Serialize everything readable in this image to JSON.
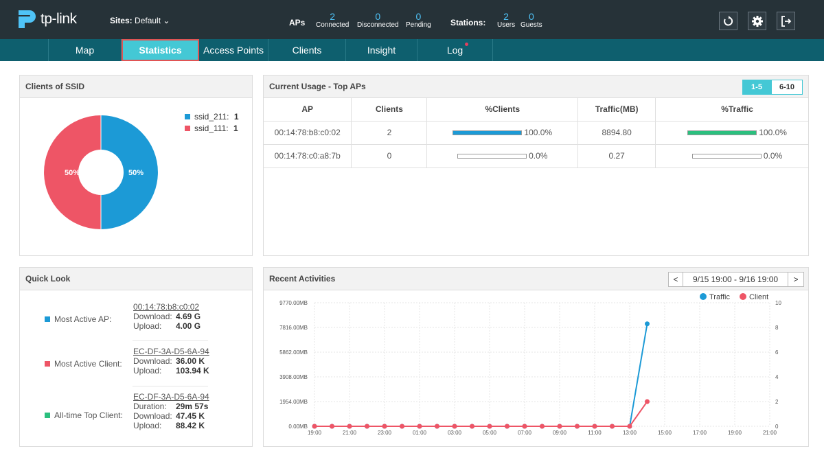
{
  "header": {
    "logo_text": "tp-link",
    "sites_label": "Sites:",
    "sites_value": "Default",
    "aps_label": "APs",
    "aps": [
      {
        "value": "2",
        "label": "Connected"
      },
      {
        "value": "0",
        "label": "Disconnected"
      },
      {
        "value": "0",
        "label": "Pending"
      }
    ],
    "stations_label": "Stations:",
    "stations": [
      {
        "value": "2",
        "label": "Users"
      },
      {
        "value": "0",
        "label": "Guests"
      }
    ],
    "buttons": [
      "refresh-icon",
      "gear-icon",
      "logout-icon"
    ]
  },
  "nav": {
    "items": [
      "Map",
      "Statistics",
      "Access Points",
      "Clients",
      "Insight",
      "Log"
    ],
    "active": "Statistics"
  },
  "clients_of_ssid": {
    "title": "Clients of SSID",
    "legend": [
      {
        "name": "ssid_211:",
        "count": "1",
        "color": "#1c9ad6"
      },
      {
        "name": "ssid_111:",
        "count": "1",
        "color": "#ee5566"
      }
    ],
    "slice_labels": [
      "50%",
      "50%"
    ]
  },
  "current_usage": {
    "title": "Current Usage - Top APs",
    "pager": [
      "1-5",
      "6-10"
    ],
    "columns": [
      "AP",
      "Clients",
      "%Clients",
      "Traffic(MB)",
      "%Traffic"
    ],
    "rows": [
      {
        "ap": "00:14:78:b8:c0:02",
        "clients": "2",
        "pct_clients": "100.0%",
        "pct_clients_fill": 1.0,
        "traffic": "8894.80",
        "pct_traffic": "100.0%",
        "pct_traffic_fill": 1.0
      },
      {
        "ap": "00:14:78:c0:a8:7b",
        "clients": "0",
        "pct_clients": "0.0%",
        "pct_clients_fill": 0.0,
        "traffic": "0.27",
        "pct_traffic": "0.0%",
        "pct_traffic_fill": 0.0
      }
    ]
  },
  "quick_look": {
    "title": "Quick Look",
    "items": [
      {
        "label": "Most Active AP:",
        "color": "#1c9ad6",
        "link": "00:14:78:b8:c0:02",
        "kv": [
          {
            "k": "Download:",
            "v": "4.69 G"
          },
          {
            "k": "Upload:",
            "v": "4.00 G"
          }
        ]
      },
      {
        "label": "Most Active Client:",
        "color": "#ee5566",
        "link": "EC-DF-3A-D5-6A-94",
        "kv": [
          {
            "k": "Download:",
            "v": "36.00 K"
          },
          {
            "k": "Upload:",
            "v": "103.94 K"
          }
        ]
      },
      {
        "label": "All-time Top Client:",
        "color": "#2bbf7e",
        "link": "EC-DF-3A-D5-6A-94",
        "kv": [
          {
            "k": "Duration:",
            "v": "29m 57s"
          },
          {
            "k": "Download:",
            "v": "47.45 K"
          },
          {
            "k": "Upload:",
            "v": "88.42 K"
          }
        ]
      }
    ]
  },
  "recent": {
    "title": "Recent Activities",
    "range": "9/15 19:00 - 9/16 19:00",
    "prev": "<",
    "next": ">"
  },
  "chart_data": {
    "type": "line",
    "x": [
      "19:00",
      "20:00",
      "21:00",
      "22:00",
      "23:00",
      "00:00",
      "01:00",
      "02:00",
      "03:00",
      "04:00",
      "05:00",
      "06:00",
      "07:00",
      "08:00",
      "09:00",
      "10:00",
      "11:00",
      "12:00",
      "13:00",
      "14:00"
    ],
    "x_ticks": [
      "19:00",
      "21:00",
      "23:00",
      "01:00",
      "03:00",
      "05:00",
      "07:00",
      "09:00",
      "11:00",
      "13:00",
      "15:00",
      "17:00",
      "19:00",
      "21:00"
    ],
    "y_left_ticks": [
      "0.00MB",
      "1954.00MB",
      "3908.00MB",
      "5862.00MB",
      "7816.00MB",
      "9770.00MB"
    ],
    "y_left_range": [
      0,
      9770
    ],
    "y_right_ticks": [
      "0",
      "2",
      "4",
      "6",
      "8",
      "10"
    ],
    "y_right_range": [
      0,
      10
    ],
    "series": [
      {
        "name": "Traffic",
        "color": "#1c9ad6",
        "axis": "left",
        "values": [
          0,
          0,
          0,
          0,
          0,
          0,
          0,
          0,
          0,
          0,
          0,
          0,
          0,
          0,
          0,
          0,
          0,
          0,
          0,
          8100
        ]
      },
      {
        "name": "Client",
        "color": "#ee5566",
        "axis": "right",
        "values": [
          0,
          0,
          0,
          0,
          0,
          0,
          0,
          0,
          0,
          0,
          0,
          0,
          0,
          0,
          0,
          0,
          0,
          0,
          0,
          2
        ]
      }
    ],
    "legend": "top-right",
    "grid": true
  }
}
